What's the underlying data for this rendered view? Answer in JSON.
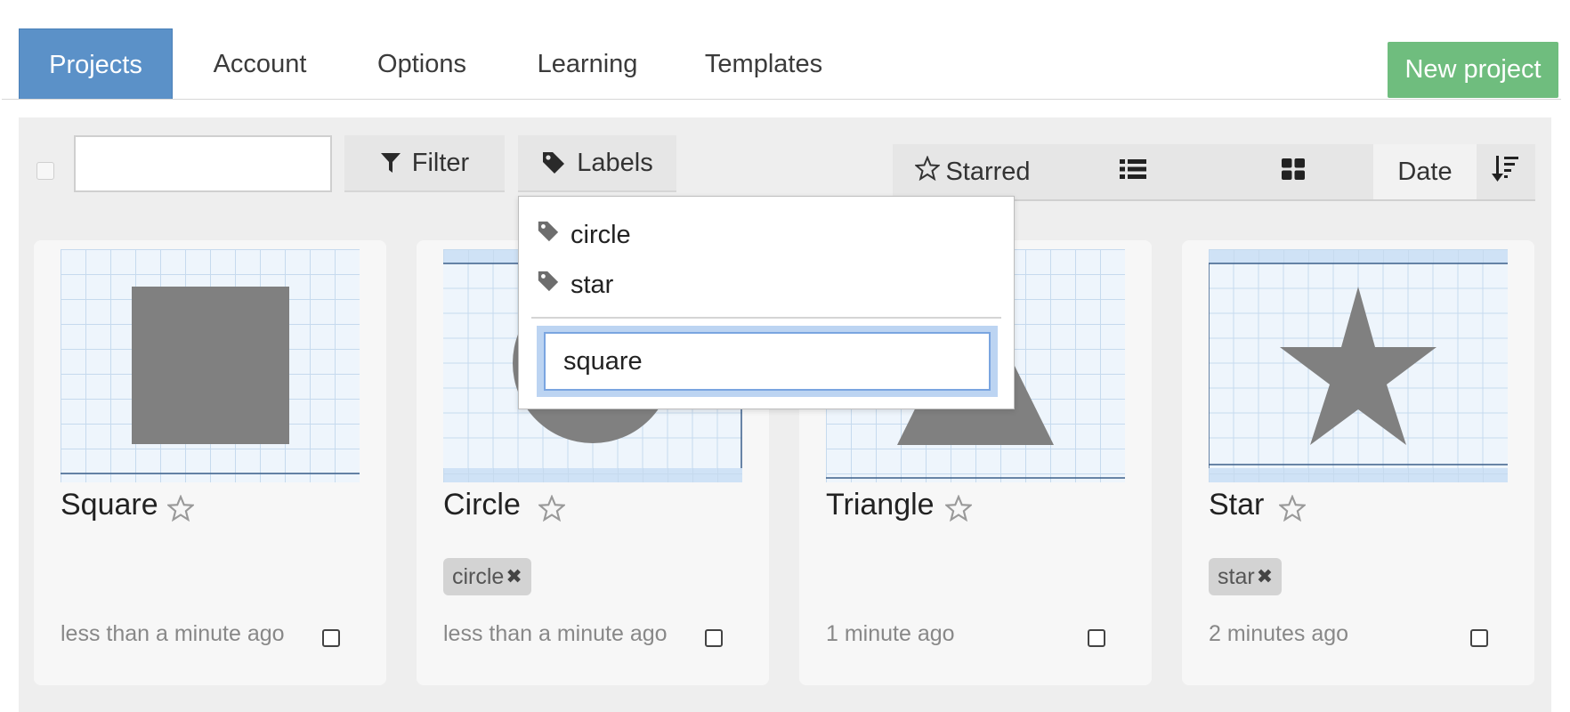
{
  "nav": {
    "tabs": [
      {
        "label": "Projects",
        "active": true
      },
      {
        "label": "Account",
        "active": false
      },
      {
        "label": "Options",
        "active": false
      },
      {
        "label": "Learning",
        "active": false
      },
      {
        "label": "Templates",
        "active": false
      }
    ],
    "new_project_label": "New project"
  },
  "toolbar": {
    "search_value": "",
    "filter_label": "Filter",
    "labels_label": "Labels",
    "starred_label": "Starred",
    "sort_label": "Date"
  },
  "labels_dropdown": {
    "items": [
      {
        "label": "circle",
        "icon": "tag-icon"
      },
      {
        "label": "star",
        "icon": "tag-icon"
      }
    ],
    "new_label_value": "square"
  },
  "projects": [
    {
      "title": "Square",
      "labels": [],
      "time": "less than a minute ago",
      "starred": false
    },
    {
      "title": "Circle",
      "labels": [
        "circle"
      ],
      "time": "less than a minute ago",
      "starred": false
    },
    {
      "title": "Triangle",
      "labels": [],
      "time": "1 minute ago",
      "starred": false
    },
    {
      "title": "Star",
      "labels": [
        "star"
      ],
      "time": "2 minutes ago",
      "starred": false
    }
  ],
  "colors": {
    "active_tab": "#5b91c8",
    "new_project": "#6fbd7e",
    "shape_fill": "#808080",
    "grid_line": "#c6daee"
  },
  "chip_remove_glyph": "✖"
}
